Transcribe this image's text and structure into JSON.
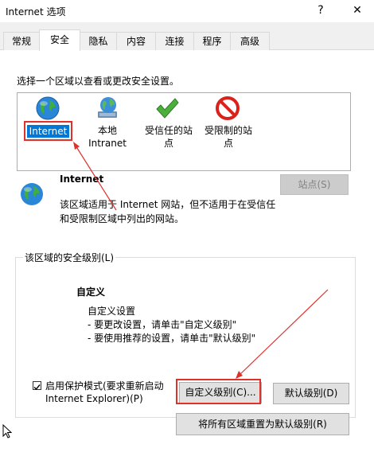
{
  "window": {
    "title": "Internet 选项",
    "help_glyph": "?",
    "close_glyph": "✕"
  },
  "tabs": [
    {
      "label": "常规"
    },
    {
      "label": "安全"
    },
    {
      "label": "隐私"
    },
    {
      "label": "内容"
    },
    {
      "label": "连接"
    },
    {
      "label": "程序"
    },
    {
      "label": "高级"
    }
  ],
  "security": {
    "instruction": "选择一个区域以查看或更改安全设置。",
    "zones": [
      {
        "label_line1": "Internet",
        "label_line2": "",
        "icon": "globe-icon",
        "selected": true
      },
      {
        "label_line1": "本地",
        "label_line2": "Intranet",
        "icon": "intranet-globe-icon"
      },
      {
        "label_line1": "受信任的站",
        "label_line2": "点",
        "icon": "checkmark-icon"
      },
      {
        "label_line1": "受限制的站",
        "label_line2": "点",
        "icon": "prohibited-icon"
      }
    ],
    "zone_title": "Internet",
    "zone_desc_line1": "该区域适用于 Internet 网站，但不适用于在受信任",
    "zone_desc_line2": "和受限制区域中列出的网站。",
    "sites_button": "站点(S)",
    "level_group_title": "该区域的安全级别(L)",
    "level_name": "自定义",
    "level_desc_line1": "自定义设置",
    "level_desc_line2": "- 要更改设置，请单击\"自定义级别\"",
    "level_desc_line3": "- 要使用推荐的设置，请单击\"默认级别\"",
    "protected_mode_line1": "启用保护模式(要求重新启动",
    "protected_mode_line2": "Internet Explorer)(P)",
    "protected_mode_checked": true,
    "custom_level_button": "自定义级别(C)...",
    "default_level_button": "默认级别(D)",
    "reset_all_button": "将所有区域重置为默认级别(R)"
  },
  "colors": {
    "selection": "#0078d7",
    "annotation_red": "#e0302a"
  }
}
